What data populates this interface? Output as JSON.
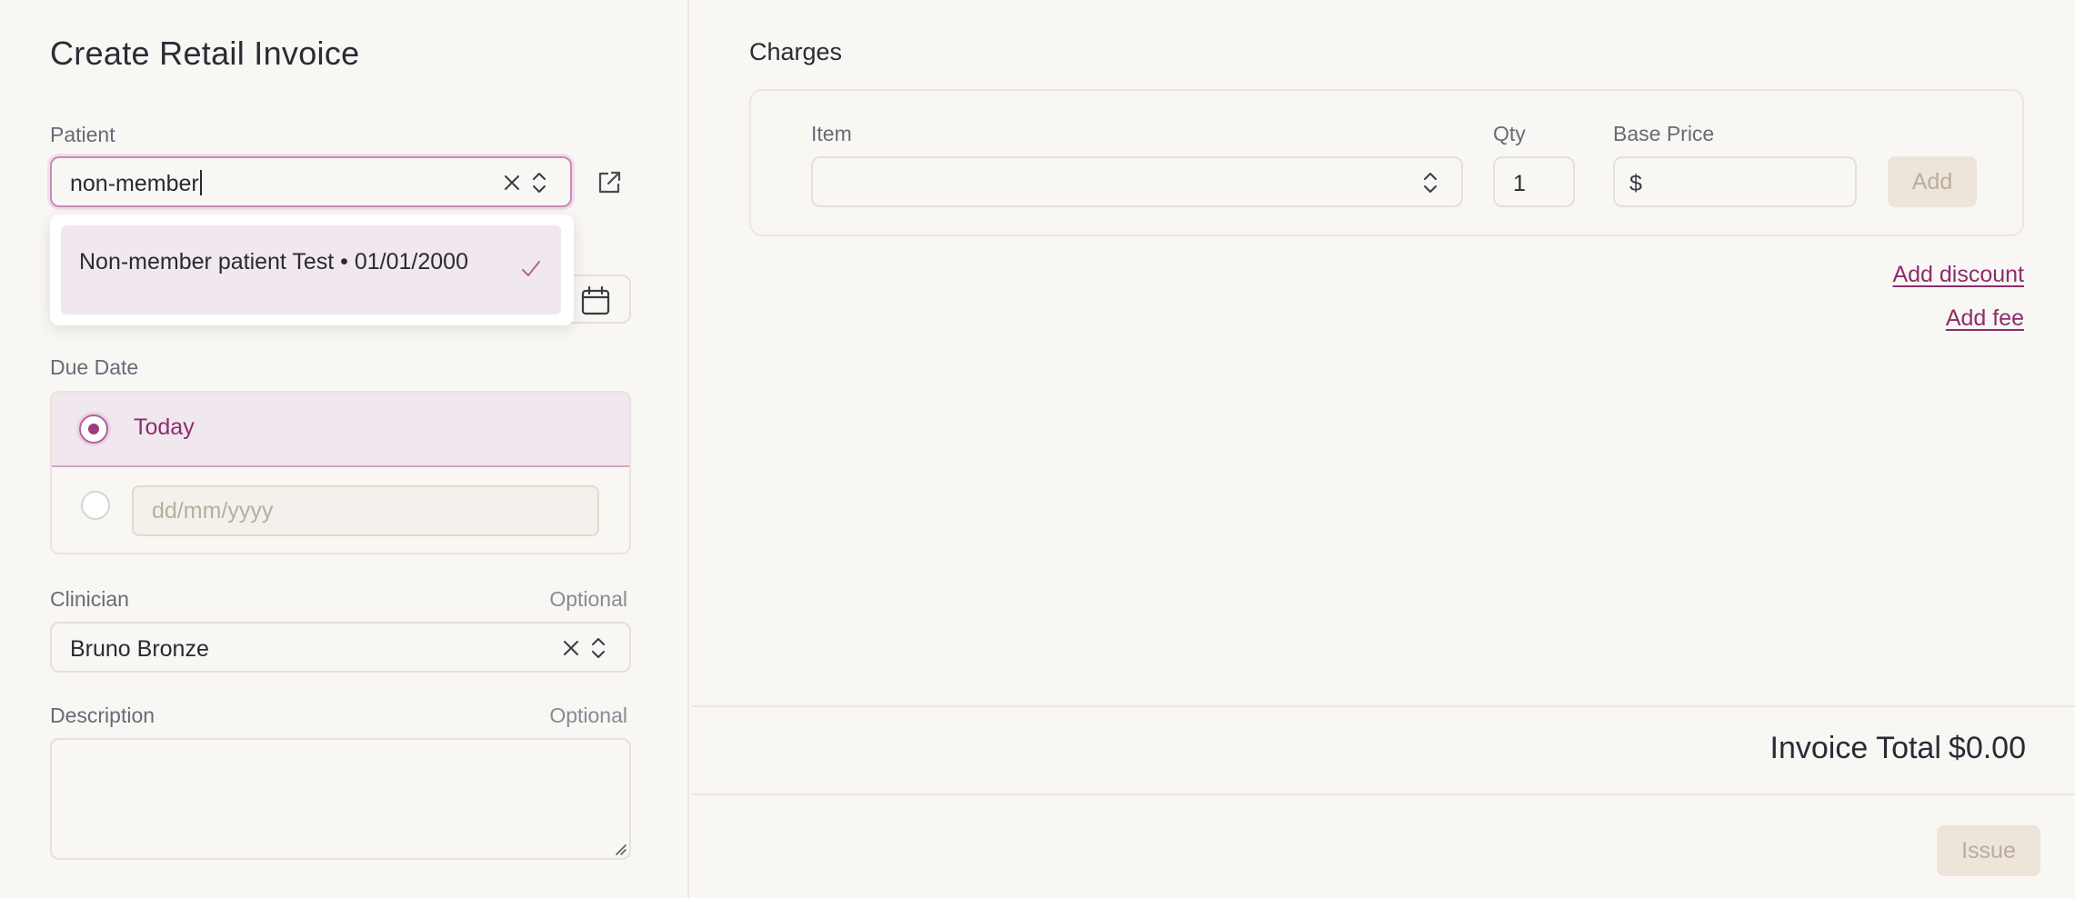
{
  "page": {
    "title": "Create Retail Invoice"
  },
  "patient": {
    "label": "Patient",
    "value": "non-member",
    "dropdown": {
      "options": [
        {
          "label": "Non-member patient Test • 01/01/2000",
          "selected": true
        }
      ]
    }
  },
  "due_date": {
    "label": "Due Date",
    "today_label": "Today",
    "date_placeholder": "dd/mm/yyyy"
  },
  "clinician": {
    "label": "Clinician",
    "optional": "Optional",
    "value": "Bruno Bronze"
  },
  "description": {
    "label": "Description",
    "optional": "Optional"
  },
  "charges": {
    "title": "Charges",
    "item_label": "Item",
    "qty_label": "Qty",
    "qty_value": "1",
    "base_price_label": "Base Price",
    "currency_symbol": "$",
    "add_label": "Add",
    "add_discount": "Add discount",
    "add_fee": "Add fee"
  },
  "footer": {
    "total_label": "Invoice Total",
    "total_value": "$0.00",
    "issue_label": "Issue"
  },
  "colors": {
    "accent": "#8c2d6e",
    "background": "#f9f7f3",
    "disabled_button": "#ede5d9"
  },
  "icons": [
    "clear-icon",
    "chevron-updown-icon",
    "external-link-icon",
    "checkmark-icon",
    "calendar-icon",
    "resize-grip-icon"
  ]
}
